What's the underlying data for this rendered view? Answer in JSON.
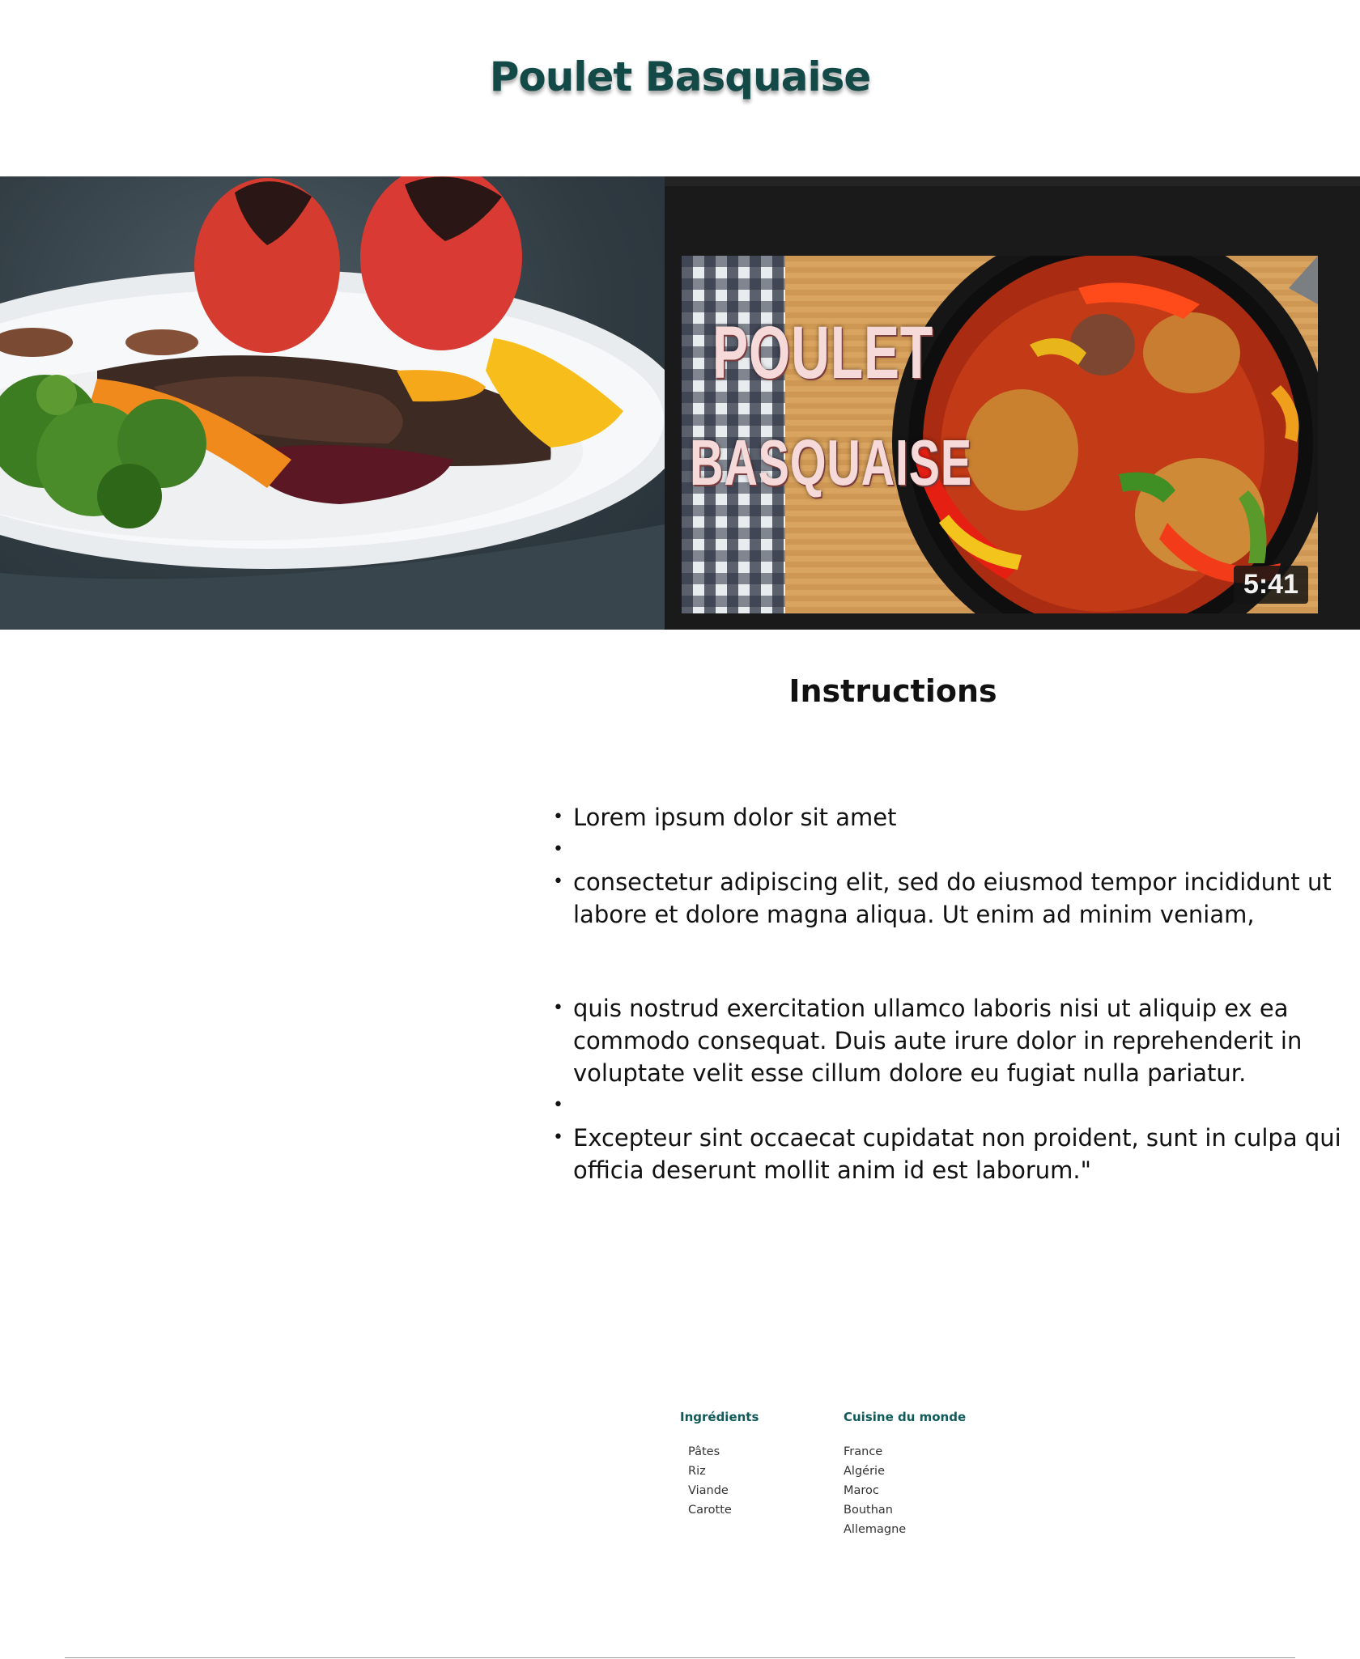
{
  "page": {
    "title": "Poulet Basquaise"
  },
  "video": {
    "thumbnail_text_line1": "POULET",
    "thumbnail_text_line2": "BASQUAISE",
    "duration": "5:41"
  },
  "instructions": {
    "heading": "Instructions",
    "steps": [
      "Lorem ipsum dolor sit amet",
      "",
      "consectetur adipiscing elit, sed do eiusmod tempor incididunt ut labore et dolore magna aliqua. Ut enim ad minim veniam,",
      " quis nostrud exercitation ullamco laboris nisi ut aliquip ex ea commodo consequat. Duis aute irure dolor in reprehenderit in voluptate velit esse cillum dolore eu fugiat nulla pariatur.",
      "",
      "Excepteur sint occaecat cupidatat non proident, sunt in culpa qui officia deserunt mollit anim id est laborum.\""
    ]
  },
  "footer": {
    "ingredients": {
      "heading": "Ingrédients",
      "items": [
        "Pâtes",
        "Riz",
        "Viande",
        "Carotte"
      ]
    },
    "world_cuisine": {
      "heading": "Cuisine du monde",
      "items": [
        "France",
        "Algérie",
        "Maroc",
        "Bouthan",
        "Allemagne"
      ]
    }
  },
  "colors": {
    "title": "#134a47",
    "footer_heading": "#0f5a5a",
    "video_bg": "#1a1a1a"
  }
}
